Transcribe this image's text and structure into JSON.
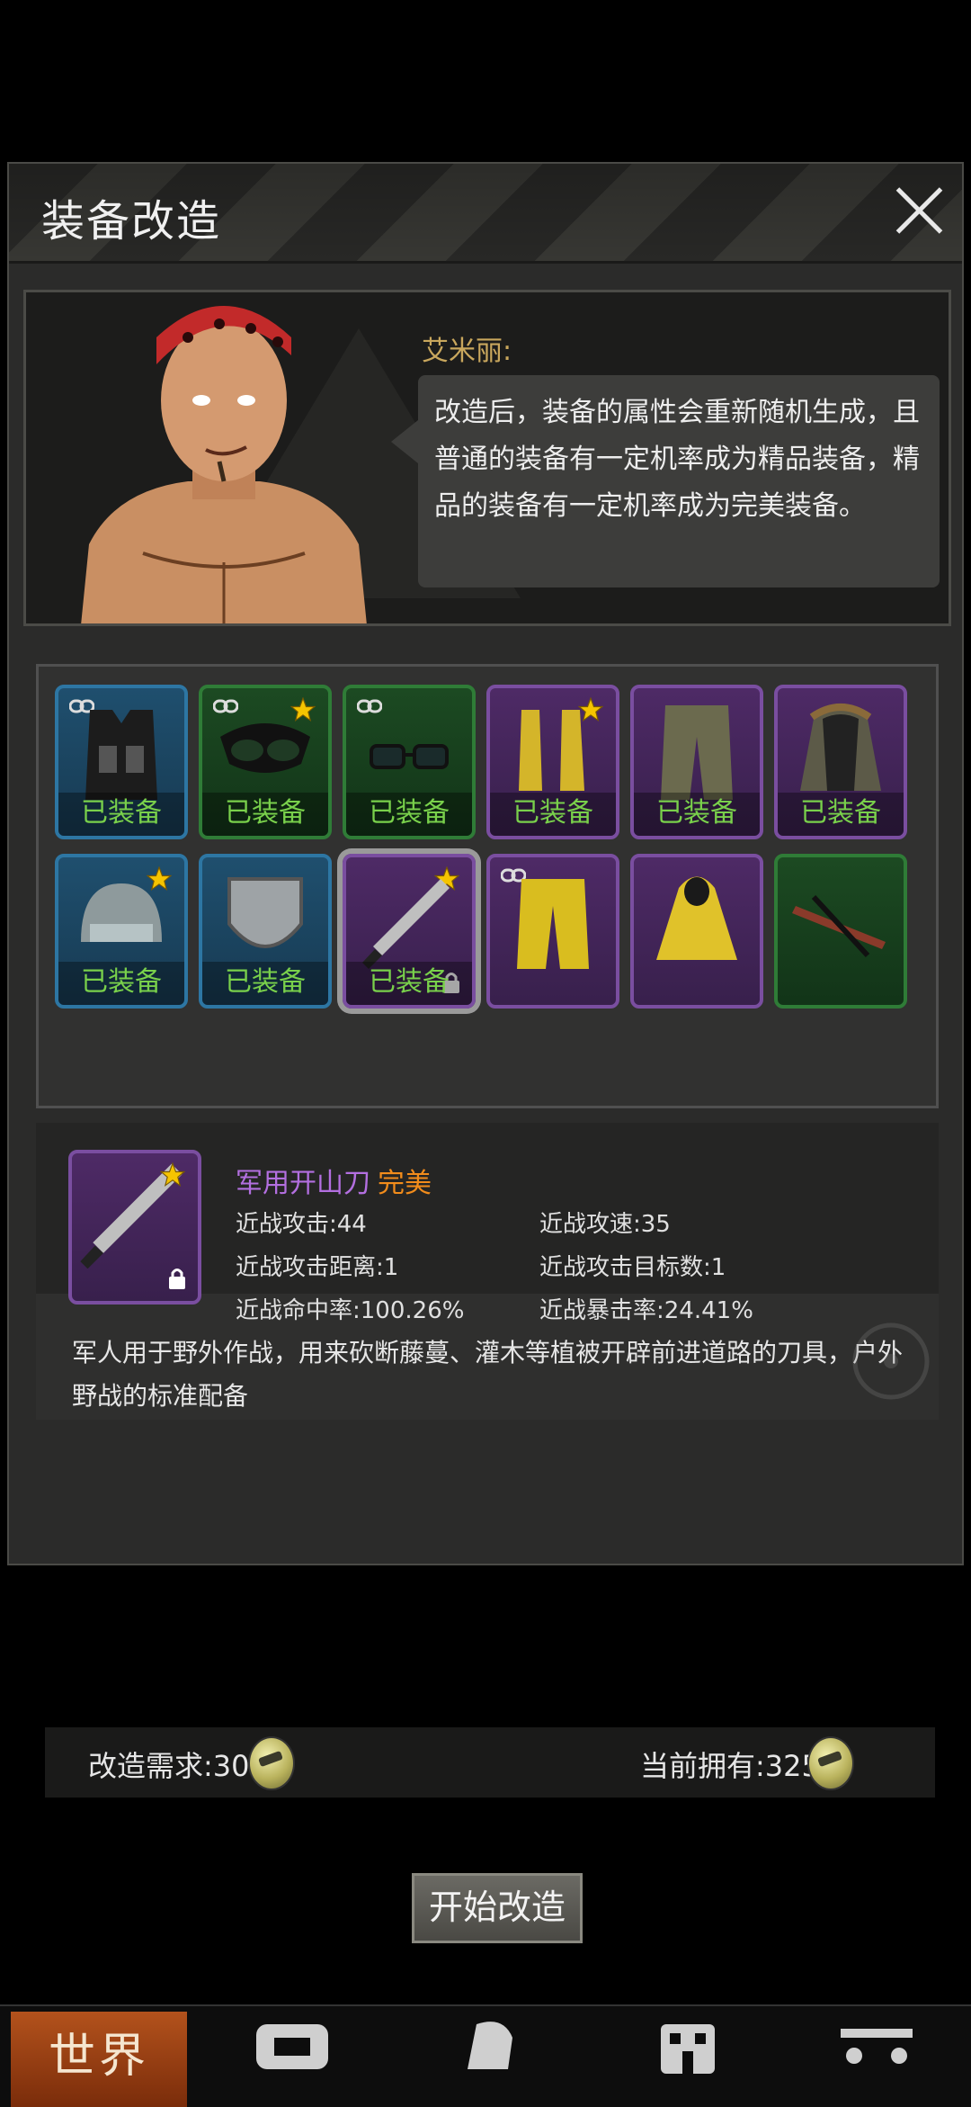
{
  "dialog": {
    "title": "装备改造",
    "close_label": "×"
  },
  "npc": {
    "name": "艾米丽:",
    "speech": "改造后，装备的属性会重新随机生成，且普通的装备有一定机率成为精品装备，精品的装备有一定机率成为完美装备。"
  },
  "inventory": {
    "equipped_label": "已装备",
    "slots": [
      {
        "item": "tactical-vest",
        "rarity": "blue",
        "equipped": true,
        "star": false,
        "linked": true
      },
      {
        "item": "night-vision-goggles",
        "rarity": "green",
        "equipped": true,
        "star": true,
        "linked": true
      },
      {
        "item": "glasses",
        "rarity": "green",
        "equipped": true,
        "star": false,
        "linked": true
      },
      {
        "item": "yellow-boots",
        "rarity": "purple",
        "equipped": true,
        "star": true,
        "linked": false
      },
      {
        "item": "camo-pants",
        "rarity": "purple",
        "equipped": true,
        "star": false,
        "linked": false
      },
      {
        "item": "fur-jacket",
        "rarity": "purple",
        "equipped": true,
        "star": false,
        "linked": false
      },
      {
        "item": "helmet",
        "rarity": "blue",
        "equipped": true,
        "star": true,
        "linked": false
      },
      {
        "item": "metal-shield",
        "rarity": "blue",
        "equipped": true,
        "star": false,
        "linked": false
      },
      {
        "item": "machete",
        "rarity": "purple",
        "equipped": true,
        "star": true,
        "linked": false,
        "locked": true,
        "selected": true
      },
      {
        "item": "yellow-pants",
        "rarity": "purple",
        "equipped": false,
        "star": false,
        "linked": true
      },
      {
        "item": "yellow-hoodie",
        "rarity": "purple",
        "equipped": false,
        "star": false,
        "linked": false
      },
      {
        "item": "crossbow",
        "rarity": "green",
        "equipped": false,
        "star": false,
        "linked": false
      }
    ]
  },
  "detail": {
    "name": "军用开山刀",
    "quality": "完美",
    "stats": {
      "melee_attack": "近战攻击:44",
      "melee_speed": "近战攻速:35",
      "melee_range": "近战攻击距离:1",
      "melee_targets": "近战攻击目标数:1",
      "melee_hit": "近战命中率:100.26%",
      "melee_crit": "近战暴击率:24.41%"
    },
    "description": "军人用于野外作战，用来砍断藤蔓、灌木等植被开辟前进道路的刀具，户外野战的标准配备"
  },
  "cost": {
    "required_label": "改造需求:30",
    "owned_label": "当前拥有:325"
  },
  "actions": {
    "start_label": "开始改造"
  },
  "nav": {
    "world_label": "世界"
  },
  "colors": {
    "equipped_text": "#79d04b",
    "item_name": "#b36fe0",
    "quality_perfect": "#f28c1b",
    "npc_name": "#c9a75d"
  }
}
